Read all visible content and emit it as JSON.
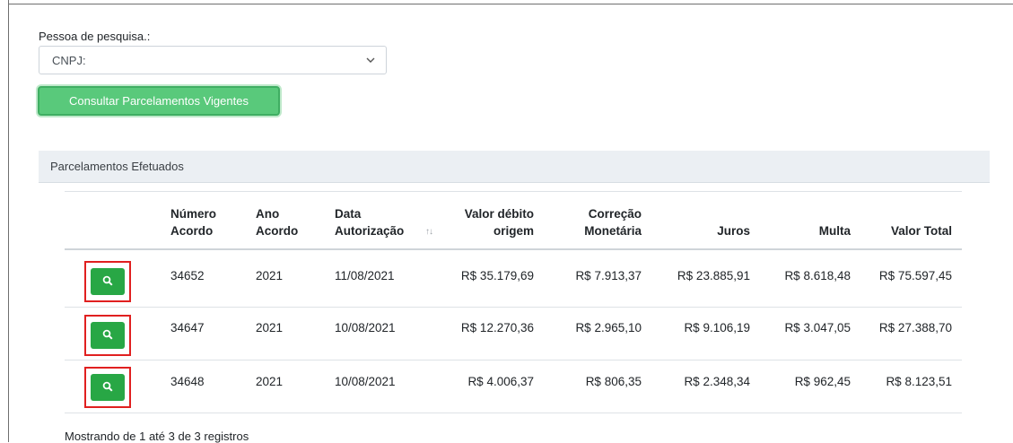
{
  "search": {
    "label": "Pessoa de pesquisa.:",
    "selected": "CNPJ:"
  },
  "consult_button": "Consultar Parcelamentos Vigentes",
  "panel": {
    "title": "Parcelamentos Efetuados"
  },
  "table": {
    "headers": {
      "numero_l1": "Número",
      "numero_l2": "Acordo",
      "ano_l1": "Ano",
      "ano_l2": "Acordo",
      "data_l1": "Data",
      "data_l2": "Autorização",
      "valor_l1": "Valor débito",
      "valor_l2": "origem",
      "correcao_l1": "Correção",
      "correcao_l2": "Monetária",
      "juros": "Juros",
      "multa": "Multa",
      "total": "Valor Total"
    },
    "sort_glyph": "↑↓",
    "rows": [
      {
        "numero": "34652",
        "ano": "2021",
        "data": "11/08/2021",
        "valor": "R$ 35.179,69",
        "correcao": "R$ 7.913,37",
        "juros": "R$ 23.885,91",
        "multa": "R$ 8.618,48",
        "total": "R$ 75.597,45"
      },
      {
        "numero": "34647",
        "ano": "2021",
        "data": "10/08/2021",
        "valor": "R$ 12.270,36",
        "correcao": "R$ 2.965,10",
        "juros": "R$ 9.106,19",
        "multa": "R$ 3.047,05",
        "total": "R$ 27.388,70"
      },
      {
        "numero": "34648",
        "ano": "2021",
        "data": "10/08/2021",
        "valor": "R$ 4.006,37",
        "correcao": "R$ 806,35",
        "juros": "R$ 2.348,34",
        "multa": "R$ 962,45",
        "total": "R$ 8.123,51"
      }
    ]
  },
  "footer": {
    "info": "Mostrando de 1 até 3 de 3 registros"
  },
  "icons": {
    "view": "search-icon",
    "select": "chevron-down-icon"
  },
  "colors": {
    "primary_button": "#59c97b",
    "row_button": "#28a745",
    "highlight_border": "#e02020",
    "panel_header": "#ebeff3"
  }
}
